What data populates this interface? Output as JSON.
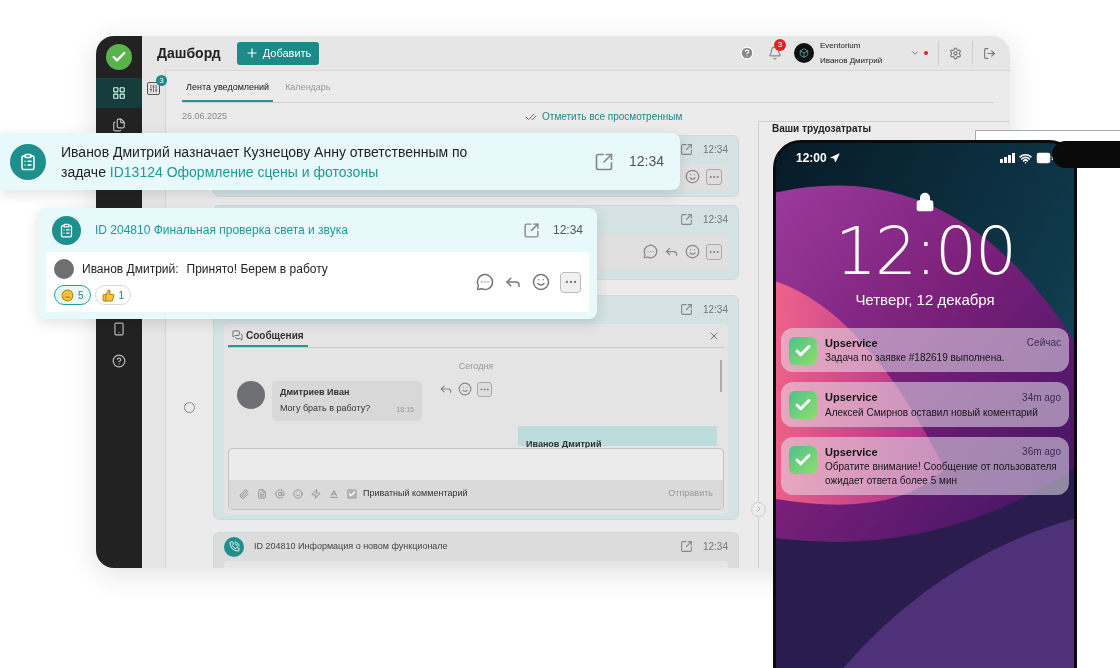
{
  "dashboard": {
    "sidebar": [
      {
        "kind": "grid",
        "selected": true
      },
      {
        "kind": "clipboard",
        "selected": false
      },
      {
        "kind": "phone",
        "selected": false
      },
      {
        "kind": "help",
        "selected": false
      }
    ],
    "header": {
      "title": "Дашборд",
      "add_button": "Добавить",
      "bell_badge": "3",
      "company": "Eventorium",
      "user": "Иванов Дмитрий",
      "online": true
    },
    "filter_badge": "3",
    "tabs": [
      {
        "label": "Лента уведомлений",
        "selected": true
      },
      {
        "label": "Календарь",
        "selected": false
      }
    ],
    "date": "26.06.2025",
    "mark_all": "Отметить все просмотренным",
    "feed": [
      {
        "kind": "plain",
        "time": "12:34"
      },
      {
        "kind": "plain",
        "time": "12:34"
      },
      {
        "kind": "chat",
        "time": "12:34",
        "selected": false
      },
      {
        "kind": "task",
        "title": "ID 204810 Информация о новом функционале",
        "time": "12:34"
      }
    ],
    "chat": {
      "tab": "Сообщения",
      "day": "Сегодня",
      "messages": [
        {
          "own": false,
          "author": "Дмитриев Иван",
          "text": "Могу брать в работу?",
          "time": "18:15"
        },
        {
          "own": true,
          "author": "Иванов Дмитрий"
        }
      ],
      "private_label": "Приватный комментарий",
      "private_checked": true,
      "send": "Отправить"
    },
    "side_panel": {
      "title": "Ваши трудозатраты"
    }
  },
  "popups": [
    {
      "kind": "assignment",
      "text": "Иванов Дмитрий назначает Кузнецову Анну ответственным по задаче",
      "link": "ID13124 Оформление сцены и фотозоны",
      "time": "12:34"
    },
    {
      "kind": "comment",
      "title": "ID 204810 Финальная проверка света и звука",
      "time": "12:34",
      "author": "Иванов Дмитрий:",
      "text": "Принято! Берем в работу",
      "reactions": [
        {
          "kind": "meh",
          "count": "5",
          "selected": true
        },
        {
          "kind": "thumbs-up",
          "count": "1",
          "selected": false
        }
      ]
    }
  ],
  "phone": {
    "status_time": "12:00",
    "clock": "12:00",
    "date": "Четверг, 12 декабря",
    "notifications": [
      {
        "app": "Upservice",
        "time": "Сейчас",
        "text": "Задача по заявке #182619 выполнена."
      },
      {
        "app": "Upservice",
        "time": "34m ago",
        "text": "Алексей Смирнов оставил новый коментарий"
      },
      {
        "app": "Upservice",
        "time": "36m ago",
        "text": "Обратите внимание! Сообщение от пользователя ожидает ответа более 5 мин"
      }
    ]
  }
}
